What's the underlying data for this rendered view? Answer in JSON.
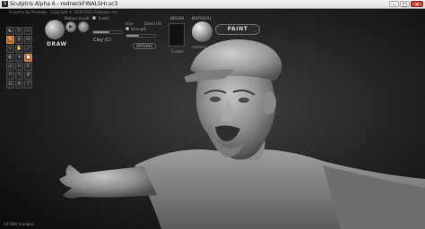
{
  "window": {
    "title": "Sculptris Alpha 6 - redneckFINALSHr.sc3",
    "app_icon": "S",
    "minimize_label": "–",
    "maximize_label": "□",
    "close_label": "✕"
  },
  "header": {
    "credit": "Sculptris by Pixologic · Copyright © 2009-2011 Pixologic, Inc."
  },
  "tools": [
    {
      "icon": "crease-icon",
      "glyph": "◣"
    },
    {
      "icon": "rotate-icon",
      "glyph": "↻"
    },
    {
      "icon": "flatten-icon",
      "glyph": "▭"
    },
    {
      "icon": "draw-icon",
      "glyph": "✎",
      "active": true
    },
    {
      "icon": "inflate-icon",
      "glyph": "◍"
    },
    {
      "icon": "pinch-icon",
      "glyph": "⋈"
    },
    {
      "icon": "smooth-icon",
      "glyph": "≈"
    },
    {
      "icon": "grab-icon",
      "glyph": "✋"
    },
    {
      "icon": "scale-icon",
      "glyph": "⤢"
    },
    {
      "icon": "mask-icon",
      "glyph": "◐"
    },
    {
      "icon": "reduce-icon",
      "glyph": "▾"
    },
    {
      "icon": "paint-icon",
      "glyph": "●",
      "active": true
    },
    {
      "icon": "bulge-icon",
      "glyph": "◎"
    },
    {
      "icon": "symmetry-icon",
      "glyph": "⇔"
    },
    {
      "icon": "flip-icon",
      "glyph": "⇅"
    },
    {
      "icon": "undo-icon",
      "glyph": "↶"
    },
    {
      "icon": "redo-icon",
      "glyph": "↷"
    },
    {
      "icon": "wire-icon",
      "glyph": "#"
    },
    {
      "icon": "lock-icon",
      "glyph": "⊟"
    },
    {
      "icon": "settings-icon",
      "glyph": "⚙"
    },
    {
      "icon": "help-icon",
      "glyph": "?"
    }
  ],
  "brush": {
    "mode_label": "DRAW",
    "reduce_label": "Reduce brush",
    "detail_label": "Detail (D)",
    "invert_label": "Invert",
    "size_label": "Size",
    "strength_label": "Strength",
    "clay_label": "Clay (C)",
    "size_value": 0.55,
    "strength_value": 0.45,
    "options_label": "OPTIONS"
  },
  "brush_panel": {
    "title": "BRUSH",
    "name": "Enable"
  },
  "material_panel": {
    "title": "MATERIAL",
    "name": "material"
  },
  "paint_button": "PAINT",
  "status": {
    "triangles": "147896 triangles"
  }
}
